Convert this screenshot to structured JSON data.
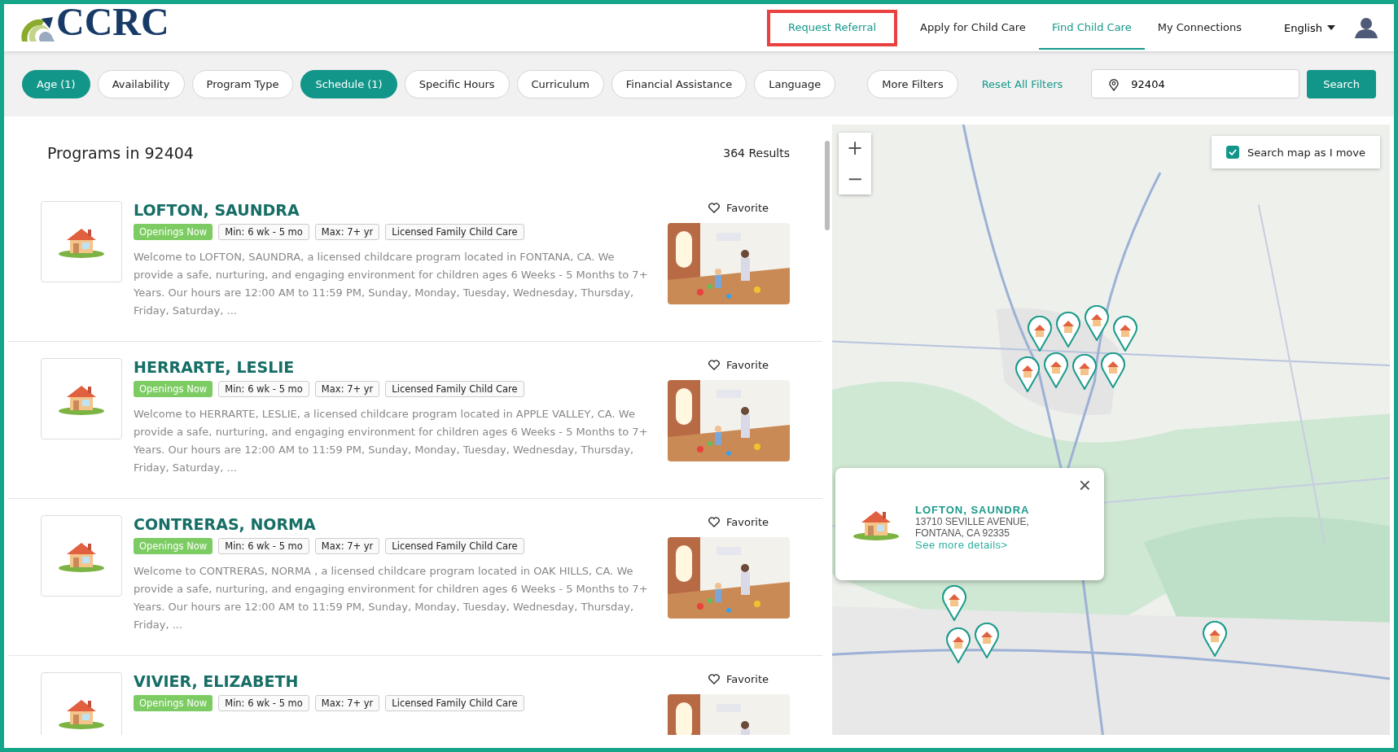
{
  "logo": {
    "text": "CCRC"
  },
  "nav": [
    {
      "label": "Request Referral",
      "selected": false,
      "highlighted": true
    },
    {
      "label": "Apply for Child Care",
      "selected": false,
      "highlighted": false
    },
    {
      "label": "Find Child Care",
      "selected": true,
      "highlighted": false
    },
    {
      "label": "My Connections",
      "selected": false,
      "highlighted": false
    }
  ],
  "language": "English",
  "filters": [
    {
      "label": "Age (1)",
      "selected": true
    },
    {
      "label": "Availability",
      "selected": false
    },
    {
      "label": "Program Type",
      "selected": false
    },
    {
      "label": "Schedule (1)",
      "selected": true
    },
    {
      "label": "Specific Hours",
      "selected": false
    },
    {
      "label": "Curriculum",
      "selected": false
    },
    {
      "label": "Financial Assistance",
      "selected": false
    },
    {
      "label": "Language",
      "selected": false
    }
  ],
  "more_filters": "More Filters",
  "reset": "Reset All Filters",
  "search": {
    "value": "92404",
    "button": "Search"
  },
  "results": {
    "title": "Programs in 92404",
    "count": "364 Results"
  },
  "programs": [
    {
      "name": "LOFTON, SAUNDRA",
      "badge": "Openings Now",
      "tags": [
        "Min: 6 wk - 5 mo",
        "Max: 7+ yr",
        "Licensed Family Child Care"
      ],
      "favorite": "Favorite",
      "description": "Welcome to LOFTON, SAUNDRA, a licensed childcare program located in FONTANA, CA. We provide a safe, nurturing, and engaging environment for children ages 6 Weeks - 5 Months to 7+ Years. Our hours are 12:00 AM to 11:59 PM, Sunday, Monday, Tuesday, Wednesday, Thursday, Friday, Saturday, ..."
    },
    {
      "name": "HERRARTE, LESLIE",
      "badge": "Openings Now",
      "tags": [
        "Min: 6 wk - 5 mo",
        "Max: 7+ yr",
        "Licensed Family Child Care"
      ],
      "favorite": "Favorite",
      "description": "Welcome to HERRARTE, LESLIE, a licensed childcare program located in APPLE VALLEY, CA. We provide a safe, nurturing, and engaging environment for children ages 6 Weeks - 5 Months to 7+ Years. Our hours are 12:00 AM to 11:59 PM, Sunday, Monday, Tuesday, Wednesday, Thursday, Friday, Saturday, ..."
    },
    {
      "name": "CONTRERAS, NORMA",
      "badge": "Openings Now",
      "tags": [
        "Min: 6 wk - 5 mo",
        "Max: 7+ yr",
        "Licensed Family Child Care"
      ],
      "favorite": "Favorite",
      "description": "Welcome to CONTRERAS, NORMA , a licensed childcare program located in OAK HILLS, CA. We provide a safe, nurturing, and engaging environment for children ages 6 Weeks - 5 Months to 7+ Years. Our hours are 12:00 AM to 11:59 PM, Sunday, Monday, Tuesday, Wednesday, Thursday, Friday, ..."
    },
    {
      "name": "VIVIER, ELIZABETH",
      "badge": "Openings Now",
      "tags": [
        "Min: 6 wk - 5 mo",
        "Max: 7+ yr",
        "Licensed Family Child Care"
      ],
      "favorite": "Favorite"
    }
  ],
  "map": {
    "zoom_in": "+",
    "zoom_out": "−",
    "search_as_move": {
      "label": "Search map as I move",
      "checked": true
    },
    "popup": {
      "name": "LOFTON, SAUNDRA",
      "address": [
        "13710 SEVILLE AVENUE,",
        "FONTANA, CA 92335"
      ],
      "link": "See more details>",
      "close": "×"
    }
  }
}
